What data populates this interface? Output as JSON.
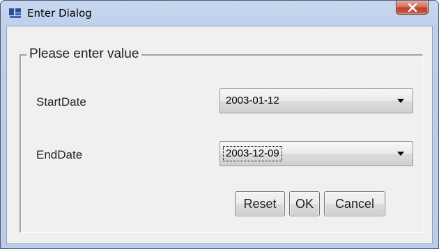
{
  "window": {
    "title": "Enter Dialog",
    "icon": "app-window-icon",
    "close_icon": "close-icon"
  },
  "group": {
    "legend": "Please enter value"
  },
  "fields": [
    {
      "label": "StartDate",
      "value": "2003-01-12"
    },
    {
      "label": "EndDate",
      "value": "2003-12-09"
    }
  ],
  "buttons": {
    "reset": "Reset",
    "ok": "OK",
    "cancel": "Cancel"
  },
  "colors": {
    "frame": "#b9cde8",
    "close_button": "#c8503a",
    "client_background": "#f0f0f0"
  }
}
